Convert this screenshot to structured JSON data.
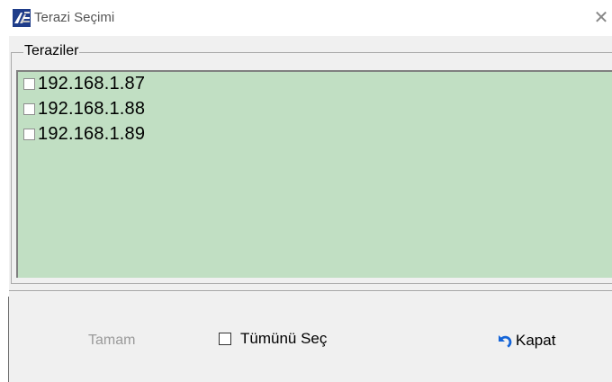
{
  "window": {
    "title": "Terazi Seçimi",
    "close_glyph": "✕",
    "icon": "app-logo-icon"
  },
  "group": {
    "legend": "Teraziler",
    "items": [
      {
        "label": "192.168.1.87",
        "checked": false
      },
      {
        "label": "192.168.1.88",
        "checked": false
      },
      {
        "label": "192.168.1.89",
        "checked": false
      }
    ],
    "list_background": "#c1dfc3"
  },
  "footer": {
    "ok_label": "Tamam",
    "ok_enabled": false,
    "select_all_label": "Tümünü Seç",
    "select_all_checked": false,
    "close_label": "Kapat",
    "close_icon": "undo-arrow-icon"
  }
}
